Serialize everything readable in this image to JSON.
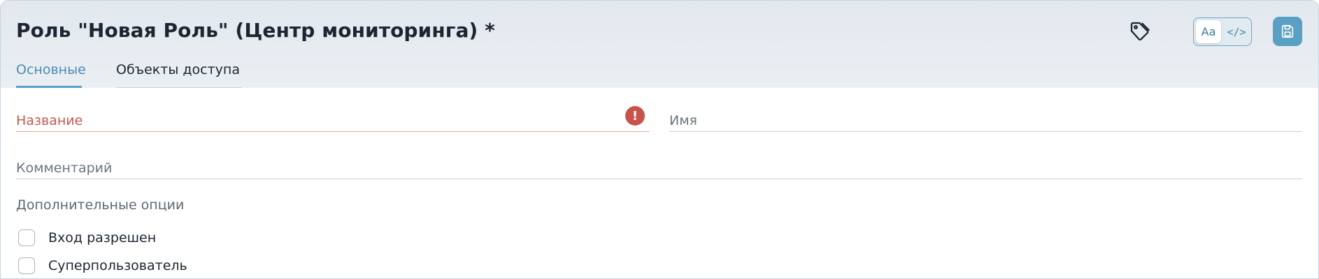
{
  "header": {
    "title": "Роль \"Новая Роль\" (Центр мониторинга) *"
  },
  "toolbar": {
    "tag_icon": "tag-icon",
    "view_toggle": {
      "text_option": "Aa",
      "code_option": "</>",
      "active": "text"
    },
    "save_icon": "save-icon"
  },
  "tabs": [
    {
      "label": "Основные",
      "active": true
    },
    {
      "label": "Объекты доступа",
      "active": false
    }
  ],
  "form": {
    "name_field": {
      "label": "Название",
      "error": true,
      "error_icon": "!"
    },
    "ident_field": {
      "label": "Имя"
    },
    "comment_field": {
      "label": "Комментарий"
    },
    "options_title": "Дополнительные опции",
    "options": [
      {
        "label": "Вход разрешен",
        "checked": false
      },
      {
        "label": "Суперпользователь",
        "checked": false
      }
    ]
  },
  "colors": {
    "accent": "#5a9fc4",
    "error": "#c9534a"
  }
}
